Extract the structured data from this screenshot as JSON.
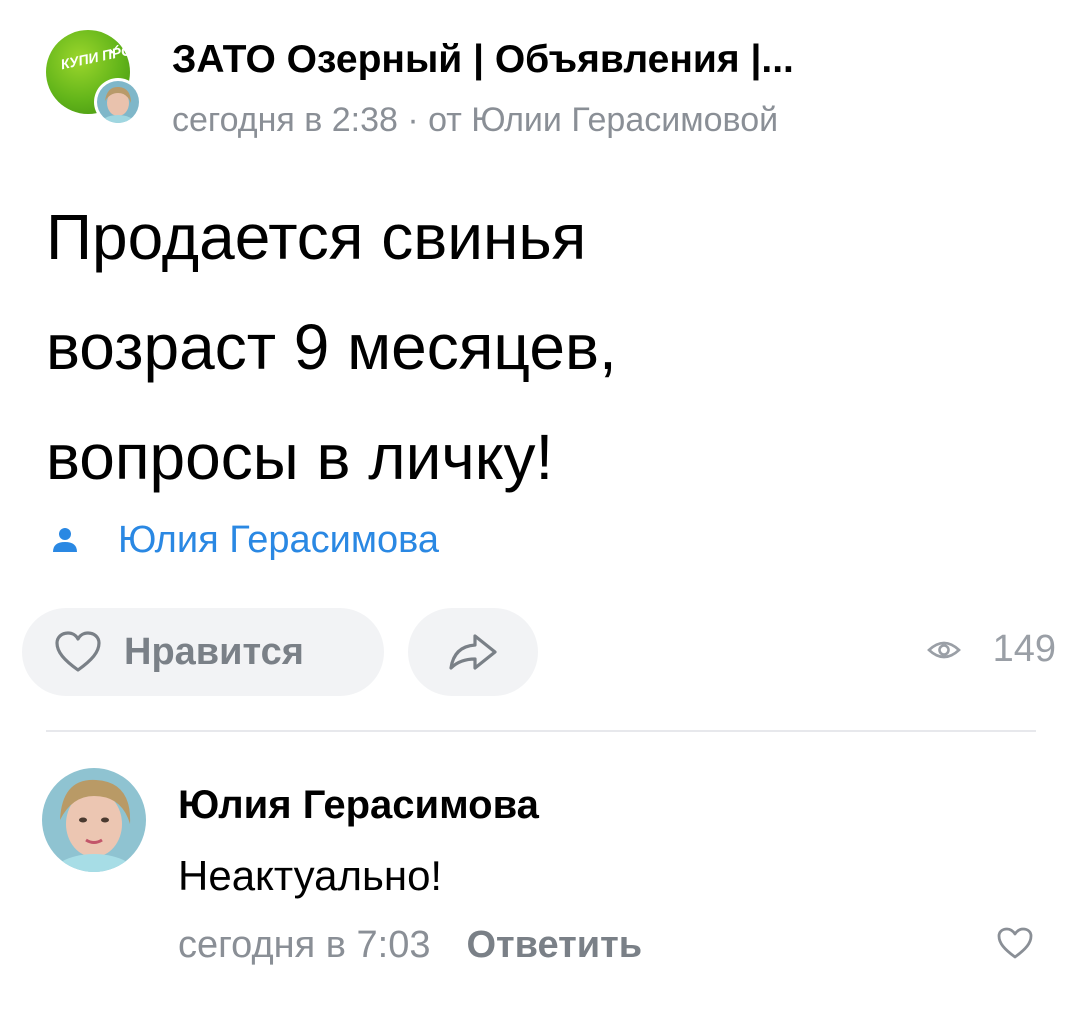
{
  "header": {
    "group_logo_text": "КУПИ ПРО",
    "group_title": "ЗАТО Озерный | Объявления |...",
    "meta": "сегодня в 2:38 · от Юлии Герасимовой"
  },
  "post": {
    "text": "Продается свинья\nвозраст 9 месяцев,\nвопросы в личку!",
    "signer_name": "Юлия Герасимова",
    "signer_icon": "user-icon"
  },
  "actions": {
    "like_label": "Нравится",
    "like_icon": "heart-icon",
    "share_icon": "share-icon",
    "views_icon": "eye-icon",
    "views_count": "149"
  },
  "comment": {
    "author": "Юлия Герасимова",
    "text": "Неактуально!",
    "time": "сегодня в 7:03",
    "reply_label": "Ответить",
    "like_icon": "heart-icon"
  },
  "colors": {
    "link_blue": "#2a88e3",
    "secondary_text": "#8a8f96",
    "button_bg": "#f2f3f5",
    "brand_green": "#63b51a"
  }
}
